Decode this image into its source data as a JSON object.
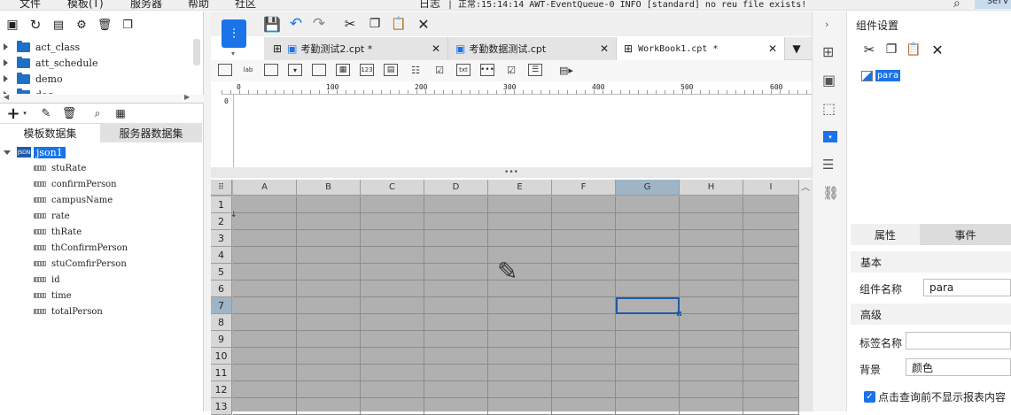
{
  "menu": [
    "文件",
    "模板(T)",
    "服务器",
    "帮助",
    "社区"
  ],
  "status": {
    "log_label": "日志",
    "message": "| 正常:15:14:14 AWT-EventQueue-0 INFO [standard] no reu file exists!",
    "server_button": "Serv"
  },
  "tree": {
    "folders": [
      "act_class",
      "att_schedule",
      "demo",
      "doc"
    ]
  },
  "dataset_tabs": [
    "模板数据集",
    "服务器数据集"
  ],
  "dataset": {
    "name": "json1",
    "fields": [
      "stuRate",
      "confirmPerson",
      "campusName",
      "rate",
      "thRate",
      "thConfirmPerson",
      "stuComfirPerson",
      "id",
      "time",
      "totalPerson"
    ]
  },
  "tabs": [
    {
      "label": "考勤测试2.cpt *"
    },
    {
      "label": "考勤数据测试.cpt"
    },
    {
      "label": "WorkBook1.cpt *"
    }
  ],
  "toolbar_widgets": [
    "lab",
    "123",
    "txt"
  ],
  "ruler": [
    "0",
    "100",
    "200",
    "300",
    "400",
    "500",
    "600"
  ],
  "ruler_v": "0",
  "sheet": {
    "columns": [
      "A",
      "B",
      "C",
      "D",
      "E",
      "F",
      "G",
      "H",
      "I"
    ],
    "rows": [
      "1",
      "2",
      "3",
      "4",
      "5",
      "6",
      "7",
      "8",
      "9",
      "10",
      "11",
      "12",
      "13"
    ],
    "selected_cell": "G7",
    "cursor_mark": "↓"
  },
  "panel": {
    "title": "组件设置",
    "widget_name": "para",
    "prop_tabs": [
      "属性",
      "事件"
    ],
    "basic_label": "基本",
    "name_label": "组件名称",
    "name_value": "para",
    "advanced_label": "高级",
    "tag_label": "标签名称",
    "tag_value": "",
    "bg_label": "背景",
    "bg_value": "颜色",
    "checkbox_label": "点击查询前不显示报表内容"
  },
  "colors": {
    "accent": "#1a73e8",
    "grid_bg": "#b0b0b0",
    "selection": "#1e5aa8"
  }
}
